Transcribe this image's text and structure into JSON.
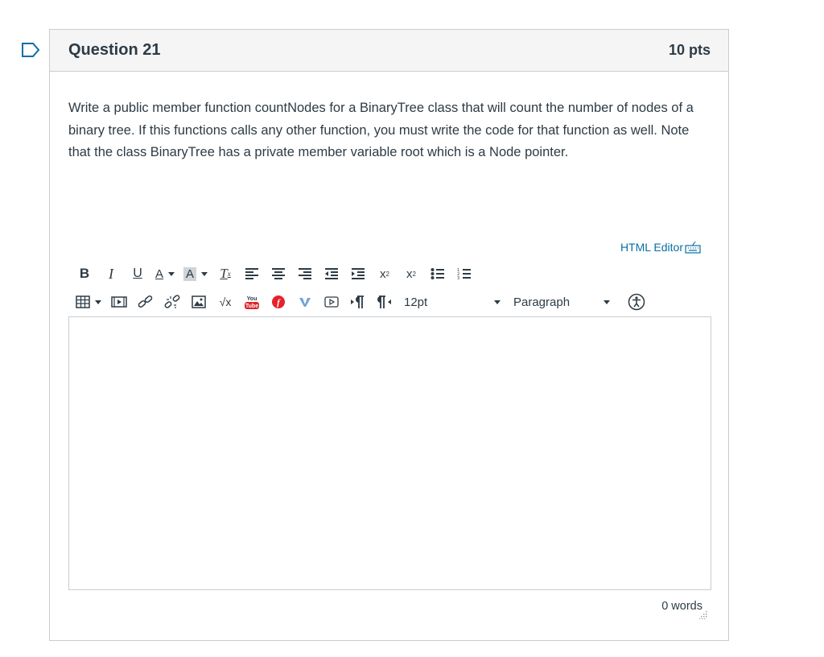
{
  "question": {
    "title": "Question 21",
    "points": "10 pts",
    "prompt": "Write a public member function countNodes  for a BinaryTree class that will count the number of nodes of a binary tree. If this functions calls any other function, you must write the code for that function as well. Note that the class BinaryTree has a private member variable root which is a Node pointer."
  },
  "editor": {
    "html_editor_link": "HTML Editor",
    "font_size": "12pt",
    "format": "Paragraph",
    "word_count": "0 words",
    "toolbar_row1": [
      "bold-icon",
      "italic-icon",
      "underline-icon",
      "text-color-icon",
      "background-color-icon",
      "clear-formatting-icon",
      "align-left-icon",
      "align-center-icon",
      "align-right-icon",
      "outdent-icon",
      "indent-icon",
      "superscript-icon",
      "subscript-icon",
      "bullet-list-icon",
      "numbered-list-icon"
    ],
    "toolbar_row2": [
      "table-icon",
      "media-icon",
      "link-icon",
      "unlink-icon",
      "image-icon",
      "equation-icon",
      "youtube-icon",
      "flickr-icon",
      "vimeo-icon",
      "embed-icon",
      "ltr-icon",
      "rtl-icon"
    ]
  },
  "colors": {
    "text": "#2d3b45",
    "link": "#0770a3",
    "border": "#c7cdd1",
    "header_bg": "#f5f5f5",
    "youtube_red": "#d9252a",
    "flickr_red": "#e6212b",
    "vimeo_blue": "#6fa3d8"
  }
}
